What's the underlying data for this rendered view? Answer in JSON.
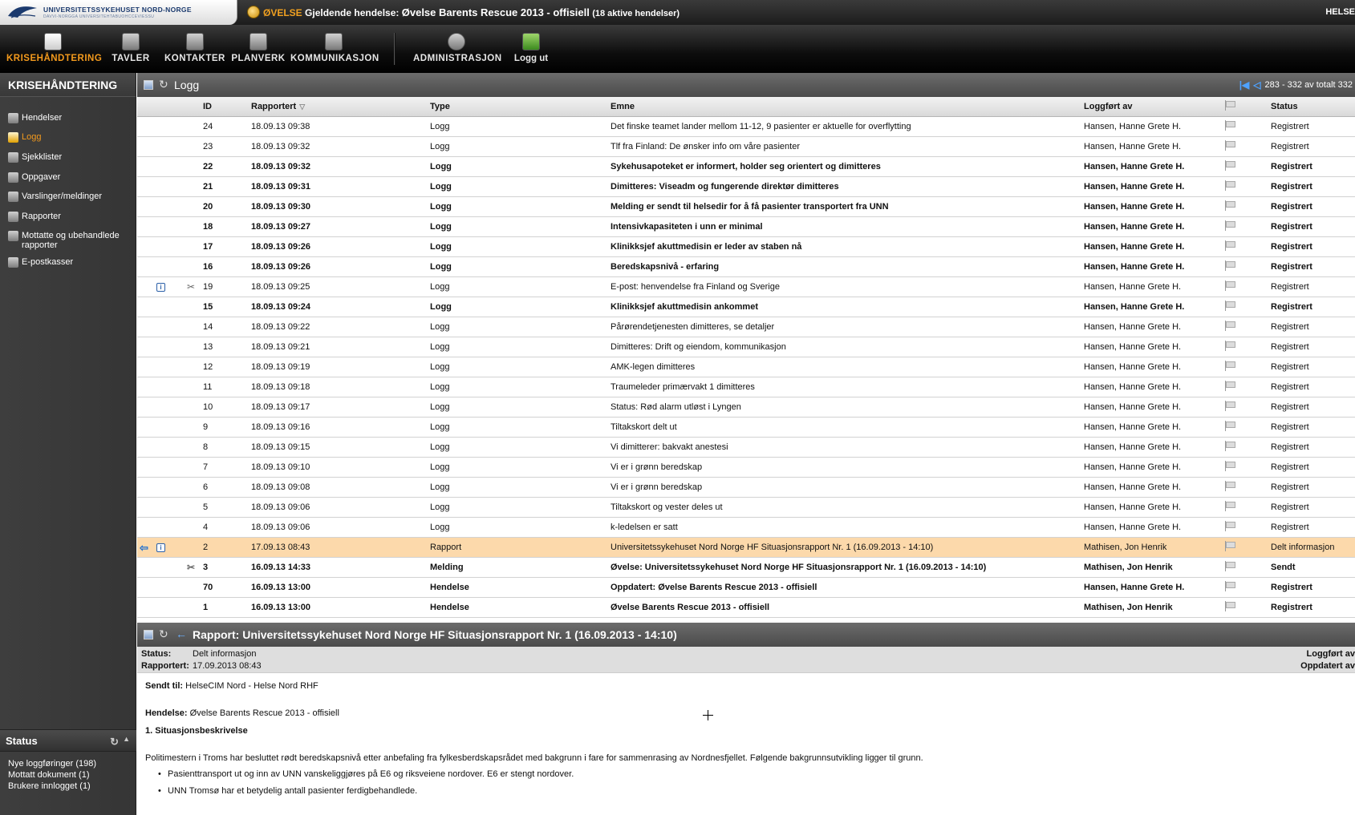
{
  "header": {
    "logo_text": "UNIVERSITETSSYKEHUSET NORD-NORGE",
    "logo_subtext": "DAVVI-NORGGA UNIVERSITEHTABUOHCCEVIESSU",
    "event_prefix": "ØVELSE",
    "event_label": "Gjeldende hendelse:",
    "event_name": "Øvelse Barents Rescue 2013 - offisiell",
    "event_count": "(18 aktive hendelser)",
    "user": "HELSE"
  },
  "nav": {
    "items": [
      {
        "label": "KRISEHÅNDTERING",
        "icon": "scroll-icon",
        "active": true
      },
      {
        "label": "TAVLER",
        "icon": "board-icon",
        "active": false
      },
      {
        "label": "KONTAKTER",
        "icon": "contacts-icon",
        "active": false
      },
      {
        "label": "PLANVERK",
        "icon": "binder-icon",
        "active": false
      },
      {
        "label": "KOMMUNIKASJON",
        "icon": "envelope-icon",
        "active": false
      },
      {
        "label": "ADMINISTRASJON",
        "icon": "gear-icon",
        "active": false
      },
      {
        "label": "Logg ut",
        "icon": "logout-icon",
        "active": false
      }
    ]
  },
  "sidebar": {
    "title": "KRISEHÅNDTERING",
    "items": [
      {
        "label": "Hendelser",
        "icon": "events-icon"
      },
      {
        "label": "Logg",
        "icon": "log-icon",
        "active": true
      },
      {
        "label": "Sjekklister",
        "icon": "checklist-icon"
      },
      {
        "label": "Oppgaver",
        "icon": "tasks-icon"
      },
      {
        "label": "Varslinger/meldinger",
        "icon": "messages-icon"
      },
      {
        "label": "Rapporter",
        "icon": "reports-icon"
      },
      {
        "label": "Mottatte og ubehandlede rapporter",
        "icon": "inbox-icon"
      },
      {
        "label": "E-postkasser",
        "icon": "mailbox-icon"
      }
    ],
    "status": {
      "title": "Status",
      "lines": [
        "Nye loggføringer (198)",
        "Mottatt dokument (1)",
        "Brukere innlogget (1)"
      ]
    }
  },
  "log_panel": {
    "title": "Logg",
    "pager": "283 - 332 av totalt 332",
    "columns": {
      "id": "ID",
      "reported": "Rapportert",
      "type": "Type",
      "subject": "Emne",
      "logged_by": "Loggført av",
      "status": "Status"
    },
    "rows": [
      {
        "id": "24",
        "reported": "18.09.13 09:38",
        "type": "Logg",
        "subject": "Det finske teamet lander mellom 11-12, 9 pasienter er aktuelle for overflytting",
        "logged_by": "Hansen, Hanne Grete H.",
        "status": "Registrert",
        "bold": false
      },
      {
        "id": "23",
        "reported": "18.09.13 09:32",
        "type": "Logg",
        "subject": "Tlf fra Finland: De ønsker info om våre pasienter",
        "logged_by": "Hansen, Hanne Grete H.",
        "status": "Registrert",
        "bold": false
      },
      {
        "id": "22",
        "reported": "18.09.13 09:32",
        "type": "Logg",
        "subject": "Sykehusapoteket er informert, holder seg orientert og dimitteres",
        "logged_by": "Hansen, Hanne Grete H.",
        "status": "Registrert",
        "bold": true
      },
      {
        "id": "21",
        "reported": "18.09.13 09:31",
        "type": "Logg",
        "subject": "Dimitteres: Viseadm og fungerende direktør dimitteres",
        "logged_by": "Hansen, Hanne Grete H.",
        "status": "Registrert",
        "bold": true
      },
      {
        "id": "20",
        "reported": "18.09.13 09:30",
        "type": "Logg",
        "subject": "Melding er sendt til helsedir for å få pasienter transportert fra UNN",
        "logged_by": "Hansen, Hanne Grete H.",
        "status": "Registrert",
        "bold": true
      },
      {
        "id": "18",
        "reported": "18.09.13 09:27",
        "type": "Logg",
        "subject": "Intensivkapasiteten i unn er minimal",
        "logged_by": "Hansen, Hanne Grete H.",
        "status": "Registrert",
        "bold": true
      },
      {
        "id": "17",
        "reported": "18.09.13 09:26",
        "type": "Logg",
        "subject": "Klinikksjef akuttmedisin er leder av staben nå",
        "logged_by": "Hansen, Hanne Grete H.",
        "status": "Registrert",
        "bold": true
      },
      {
        "id": "16",
        "reported": "18.09.13 09:26",
        "type": "Logg",
        "subject": "Beredskapsnivå - erfaring",
        "logged_by": "Hansen, Hanne Grete H.",
        "status": "Registrert",
        "bold": true
      },
      {
        "id": "19",
        "reported": "18.09.13 09:25",
        "type": "Logg",
        "subject": "E-post: henvendelse fra Finland og Sverige",
        "logged_by": "Hansen, Hanne Grete H.",
        "status": "Registrert",
        "bold": false,
        "info": true,
        "clip": true
      },
      {
        "id": "15",
        "reported": "18.09.13 09:24",
        "type": "Logg",
        "subject": "Klinikksjef akuttmedisin ankommet",
        "logged_by": "Hansen, Hanne Grete H.",
        "status": "Registrert",
        "bold": true
      },
      {
        "id": "14",
        "reported": "18.09.13 09:22",
        "type": "Logg",
        "subject": "Pårørendetjenesten dimitteres, se detaljer",
        "logged_by": "Hansen, Hanne Grete H.",
        "status": "Registrert",
        "bold": false
      },
      {
        "id": "13",
        "reported": "18.09.13 09:21",
        "type": "Logg",
        "subject": "Dimitteres: Drift og eiendom, kommunikasjon",
        "logged_by": "Hansen, Hanne Grete H.",
        "status": "Registrert",
        "bold": false
      },
      {
        "id": "12",
        "reported": "18.09.13 09:19",
        "type": "Logg",
        "subject": "AMK-legen dimitteres",
        "logged_by": "Hansen, Hanne Grete H.",
        "status": "Registrert",
        "bold": false
      },
      {
        "id": "11",
        "reported": "18.09.13 09:18",
        "type": "Logg",
        "subject": "Traumeleder primærvakt 1 dimitteres",
        "logged_by": "Hansen, Hanne Grete H.",
        "status": "Registrert",
        "bold": false
      },
      {
        "id": "10",
        "reported": "18.09.13 09:17",
        "type": "Logg",
        "subject": "Status: Rød alarm utløst i Lyngen",
        "logged_by": "Hansen, Hanne Grete H.",
        "status": "Registrert",
        "bold": false
      },
      {
        "id": "9",
        "reported": "18.09.13 09:16",
        "type": "Logg",
        "subject": "Tiltakskort delt ut",
        "logged_by": "Hansen, Hanne Grete H.",
        "status": "Registrert",
        "bold": false
      },
      {
        "id": "8",
        "reported": "18.09.13 09:15",
        "type": "Logg",
        "subject": "Vi dimitterer: bakvakt anestesi",
        "logged_by": "Hansen, Hanne Grete H.",
        "status": "Registrert",
        "bold": false
      },
      {
        "id": "7",
        "reported": "18.09.13 09:10",
        "type": "Logg",
        "subject": "Vi er i grønn beredskap",
        "logged_by": "Hansen, Hanne Grete H.",
        "status": "Registrert",
        "bold": false
      },
      {
        "id": "6",
        "reported": "18.09.13 09:08",
        "type": "Logg",
        "subject": "Vi er i grønn beredskap",
        "logged_by": "Hansen, Hanne Grete H.",
        "status": "Registrert",
        "bold": false
      },
      {
        "id": "5",
        "reported": "18.09.13 09:06",
        "type": "Logg",
        "subject": "Tiltakskort og vester deles ut",
        "logged_by": "Hansen, Hanne Grete H.",
        "status": "Registrert",
        "bold": false
      },
      {
        "id": "4",
        "reported": "18.09.13 09:06",
        "type": "Logg",
        "subject": "k-ledelsen er satt",
        "logged_by": "Hansen, Hanne Grete H.",
        "status": "Registrert",
        "bold": false
      },
      {
        "id": "2",
        "reported": "17.09.13 08:43",
        "type": "Rapport",
        "subject": "Universitetssykehuset Nord Norge HF Situasjonsrapport Nr. 1 (16.09.2013 - 14:10)",
        "logged_by": "Mathisen, Jon Henrik",
        "status": "Delt informasjon",
        "bold": false,
        "selected": true,
        "arrow": true,
        "info": true
      },
      {
        "id": "3",
        "reported": "16.09.13 14:33",
        "type": "Melding",
        "subject": "Øvelse: Universitetssykehuset Nord Norge HF Situasjonsrapport Nr. 1 (16.09.2013 - 14:10)",
        "logged_by": "Mathisen, Jon Henrik",
        "status": "Sendt",
        "bold": true,
        "clip": true
      },
      {
        "id": "70",
        "reported": "16.09.13 13:00",
        "type": "Hendelse",
        "subject": "Oppdatert: Øvelse Barents Rescue 2013 - offisiell",
        "logged_by": "Hansen, Hanne Grete H.",
        "status": "Registrert",
        "bold": true
      },
      {
        "id": "1",
        "reported": "16.09.13 13:00",
        "type": "Hendelse",
        "subject": "Øvelse Barents Rescue 2013 - offisiell",
        "logged_by": "Mathisen, Jon Henrik",
        "status": "Registrert",
        "bold": true
      }
    ]
  },
  "report_panel": {
    "title": "Rapport: Universitetssykehuset Nord Norge HF Situasjonsrapport Nr. 1 (16.09.2013 - 14:10)",
    "status_label": "Status:",
    "status_value": "Delt informasjon",
    "reported_label": "Rapportert:",
    "reported_value": "17.09.2013 08:43",
    "logged_by_label": "Loggført av",
    "updated_label": "Oppdatert av",
    "sent_to_label": "Sendt til:",
    "sent_to_value": "HelseCIM Nord - Helse Nord RHF",
    "event_label": "Hendelse:",
    "event_value": "Øvelse Barents Rescue 2013 - offisiell",
    "section_title": "1. Situasjonsbeskrivelse",
    "paragraph": "Politimestern i Troms har besluttet rødt beredskapsnivå etter anbefaling fra fylkesberdskapsrådet med bakgrunn i fare for sammenrasing av Nordnesfjellet. Følgende bakgrunnsutvikling ligger til grunn.",
    "bullets": [
      "Pasienttransport ut og inn av UNN vanskeliggjøres på E6 og riksveiene nordover. E6 er stengt nordover.",
      "UNN Tromsø har et betydelig antall pasienter ferdigbehandlede."
    ]
  }
}
